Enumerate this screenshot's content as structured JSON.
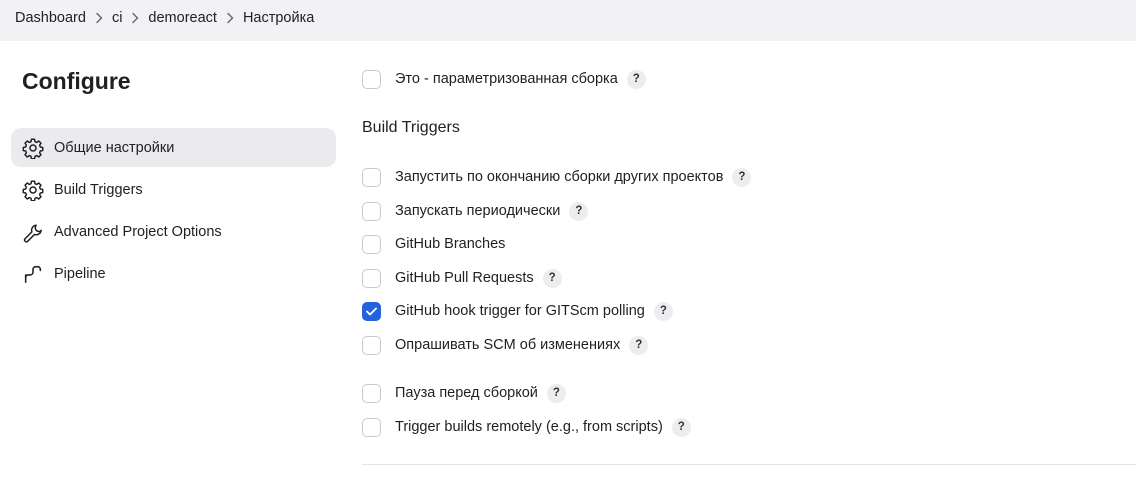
{
  "breadcrumb": [
    "Dashboard",
    "ci",
    "demoreact",
    "Настройка"
  ],
  "page_title": "Configure",
  "sidebar": {
    "items": [
      {
        "label": "Общие настройки",
        "icon": "gear-icon",
        "active": true
      },
      {
        "label": "Build Triggers",
        "icon": "gear-icon",
        "active": false
      },
      {
        "label": "Advanced Project Options",
        "icon": "wrench-icon",
        "active": false
      },
      {
        "label": "Pipeline",
        "icon": "pipeline-icon",
        "active": false
      }
    ]
  },
  "general": {
    "parameterized": {
      "label": "Это - параметризованная сборка",
      "checked": false,
      "help": "?"
    }
  },
  "triggers": {
    "title": "Build Triggers",
    "options": [
      {
        "label": "Запустить по окончанию сборки других проектов",
        "checked": false,
        "help": "?"
      },
      {
        "label": "Запускать периодически",
        "checked": false,
        "help": "?"
      },
      {
        "label": "GitHub Branches",
        "checked": false,
        "help": ""
      },
      {
        "label": "GitHub Pull Requests",
        "checked": false,
        "help": "?"
      },
      {
        "label": "GitHub hook trigger for GITScm polling",
        "checked": true,
        "help": "?"
      },
      {
        "label": "Опрашивать SCM об изменениях",
        "checked": false,
        "help": "?"
      }
    ]
  },
  "advanced": {
    "options": [
      {
        "label": "Пауза перед сборкой",
        "checked": false,
        "help": "?"
      },
      {
        "label": "Trigger builds remotely (e.g., from scripts)",
        "checked": false,
        "help": "?"
      }
    ]
  },
  "colors": {
    "accent": "#2563de",
    "topbar": "#f2f2f5",
    "active_nav": "#ebebee"
  }
}
